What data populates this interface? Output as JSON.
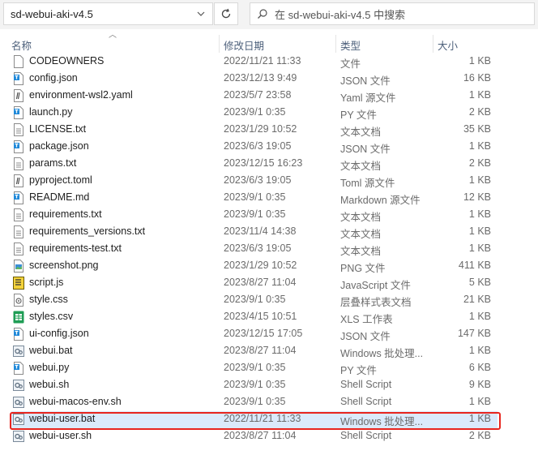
{
  "address_bar": {
    "path": "sd-webui-aki-v4.5"
  },
  "search": {
    "placeholder": "在 sd-webui-aki-v4.5 中搜索"
  },
  "columns": {
    "name": "名称",
    "date": "修改日期",
    "type": "类型",
    "size": "大小"
  },
  "files": [
    {
      "name": "CODEOWNERS",
      "date": "2022/11/21 11:33",
      "type": "文件",
      "size": "1 KB",
      "icon": "generic-file-icon"
    },
    {
      "name": "config.json",
      "date": "2023/12/13 9:49",
      "type": "JSON 文件",
      "size": "16 KB",
      "icon": "json-file-icon"
    },
    {
      "name": "environment-wsl2.yaml",
      "date": "2023/5/7 23:58",
      "type": "Yaml 源文件",
      "size": "1 KB",
      "icon": "yaml-file-icon"
    },
    {
      "name": "launch.py",
      "date": "2023/9/1 0:35",
      "type": "PY 文件",
      "size": "2 KB",
      "icon": "python-file-icon"
    },
    {
      "name": "LICENSE.txt",
      "date": "2023/1/29 10:52",
      "type": "文本文档",
      "size": "35 KB",
      "icon": "text-file-icon"
    },
    {
      "name": "package.json",
      "date": "2023/6/3 19:05",
      "type": "JSON 文件",
      "size": "1 KB",
      "icon": "json-file-icon"
    },
    {
      "name": "params.txt",
      "date": "2023/12/15 16:23",
      "type": "文本文档",
      "size": "2 KB",
      "icon": "text-file-icon"
    },
    {
      "name": "pyproject.toml",
      "date": "2023/6/3 19:05",
      "type": "Toml 源文件",
      "size": "1 KB",
      "icon": "toml-file-icon"
    },
    {
      "name": "README.md",
      "date": "2023/9/1 0:35",
      "type": "Markdown 源文件",
      "size": "12 KB",
      "icon": "markdown-file-icon"
    },
    {
      "name": "requirements.txt",
      "date": "2023/9/1 0:35",
      "type": "文本文档",
      "size": "1 KB",
      "icon": "text-file-icon"
    },
    {
      "name": "requirements_versions.txt",
      "date": "2023/11/4 14:38",
      "type": "文本文档",
      "size": "1 KB",
      "icon": "text-file-icon"
    },
    {
      "name": "requirements-test.txt",
      "date": "2023/6/3 19:05",
      "type": "文本文档",
      "size": "1 KB",
      "icon": "text-file-icon"
    },
    {
      "name": "screenshot.png",
      "date": "2023/1/29 10:52",
      "type": "PNG 文件",
      "size": "411 KB",
      "icon": "image-file-icon"
    },
    {
      "name": "script.js",
      "date": "2023/8/27 11:04",
      "type": "JavaScript 文件",
      "size": "5 KB",
      "icon": "javascript-file-icon"
    },
    {
      "name": "style.css",
      "date": "2023/9/1 0:35",
      "type": "层叠样式表文档",
      "size": "21 KB",
      "icon": "css-file-icon"
    },
    {
      "name": "styles.csv",
      "date": "2023/4/15 10:51",
      "type": "XLS 工作表",
      "size": "1 KB",
      "icon": "spreadsheet-file-icon"
    },
    {
      "name": "ui-config.json",
      "date": "2023/12/15 17:05",
      "type": "JSON 文件",
      "size": "147 KB",
      "icon": "json-file-icon"
    },
    {
      "name": "webui.bat",
      "date": "2023/8/27 11:04",
      "type": "Windows 批处理...",
      "size": "1 KB",
      "icon": "batch-file-icon"
    },
    {
      "name": "webui.py",
      "date": "2023/9/1 0:35",
      "type": "PY 文件",
      "size": "6 KB",
      "icon": "python-file-icon"
    },
    {
      "name": "webui.sh",
      "date": "2023/9/1 0:35",
      "type": "Shell Script",
      "size": "9 KB",
      "icon": "shell-file-icon"
    },
    {
      "name": "webui-macos-env.sh",
      "date": "2023/9/1 0:35",
      "type": "Shell Script",
      "size": "1 KB",
      "icon": "shell-file-icon"
    },
    {
      "name": "webui-user.bat",
      "date": "2022/11/21 11:33",
      "type": "Windows 批处理...",
      "size": "1 KB",
      "icon": "batch-file-icon",
      "selected": true
    },
    {
      "name": "webui-user.sh",
      "date": "2023/8/27 11:04",
      "type": "Shell Script",
      "size": "2 KB",
      "icon": "shell-file-icon"
    }
  ],
  "colors": {
    "selection": "#dbeafb",
    "highlight_border": "#e8251e"
  }
}
